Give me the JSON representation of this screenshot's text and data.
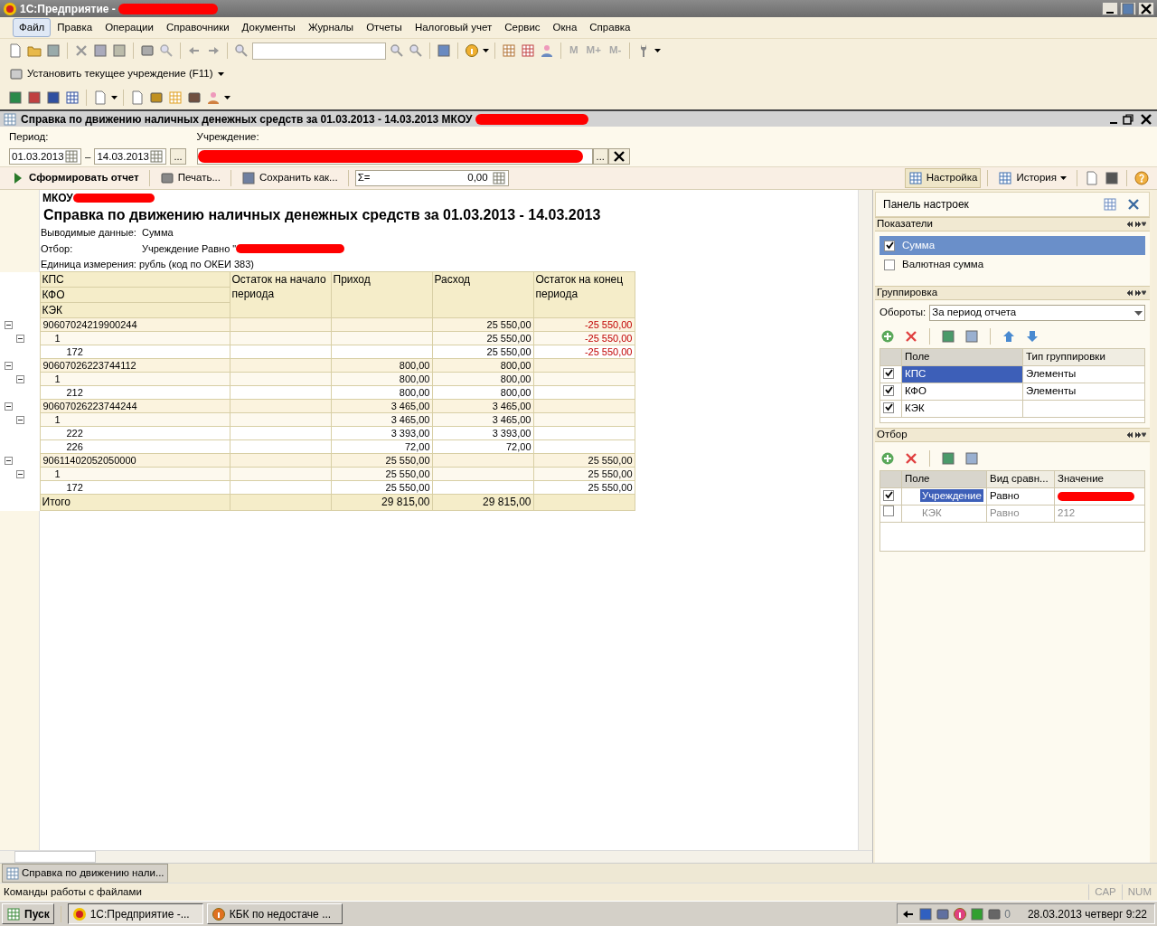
{
  "window": {
    "title": "1С:Предприятие -"
  },
  "menu": [
    {
      "label": "Файл",
      "selected": true
    },
    {
      "label": "Правка",
      "selected": false
    },
    {
      "label": "Операции",
      "selected": false
    },
    {
      "label": "Справочники",
      "selected": false
    },
    {
      "label": "Документы",
      "selected": false
    },
    {
      "label": "Журналы",
      "selected": false
    },
    {
      "label": "Отчеты",
      "selected": false
    },
    {
      "label": "Налоговый учет",
      "selected": false
    },
    {
      "label": "Сервис",
      "selected": false
    },
    {
      "label": "Окна",
      "selected": false
    },
    {
      "label": "Справка",
      "selected": false
    }
  ],
  "toolbar": {
    "memory_buttons": [
      "M",
      "M+",
      "M-"
    ]
  },
  "quick_toolbar": {
    "button": "Установить текущее учреждение (F11)"
  },
  "report_window": {
    "title": "Справка по движению наличных денежных средств за 01.03.2013 - 14.03.2013 МКОУ"
  },
  "form": {
    "period_label": "Период:",
    "date_from": "01.03.2013",
    "date_separator": "–",
    "date_to": "14.03.2013",
    "period_button": "...",
    "institution_label": "Учреждение:",
    "institution_button": "..."
  },
  "command_bar": {
    "buttons": [
      {
        "label": "Сформировать отчет"
      },
      {
        "label": "Печать..."
      },
      {
        "label": "Сохранить как..."
      }
    ],
    "sum_prefix": "Σ=",
    "sum_value": "0,00",
    "right_buttons": [
      {
        "label": "Настройка",
        "selected": true
      },
      {
        "label": "История",
        "selected": false
      }
    ]
  },
  "report": {
    "org_label": "МКОУ",
    "title": "Справка по движению наличных денежных средств за 01.03.2013 - 14.03.2013",
    "params": [
      {
        "label": "Выводимые данные:",
        "value": "Сумма"
      },
      {
        "label": "Отбор:",
        "value": "Учреждение Равно \""
      }
    ],
    "unit": "Единица измерения: рубль (код по ОКЕИ 383)",
    "row_fields": [
      "КПС",
      "КФО",
      "КЭК"
    ],
    "columns": [
      "Остаток на начало периода",
      "Приход",
      "Расход",
      "Остаток на конец периода"
    ],
    "rows": [
      {
        "code": "90607024219900244",
        "cells": [
          "",
          "",
          "25 550,00",
          "-25 550,00"
        ],
        "negative_end": true,
        "expanded": true,
        "children": [
          {
            "code": "1",
            "cells": [
              "",
              "",
              "25 550,00",
              "-25 550,00"
            ],
            "negative_end": true,
            "expanded": true,
            "children": [
              {
                "code": "172",
                "cells": [
                  "",
                  "",
                  "25 550,00",
                  "-25 550,00"
                ],
                "negative_end": true
              }
            ]
          }
        ]
      },
      {
        "code": "90607026223744112",
        "cells": [
          "",
          "800,00",
          "800,00",
          ""
        ],
        "negative_end": false,
        "expanded": true,
        "children": [
          {
            "code": "1",
            "cells": [
              "",
              "800,00",
              "800,00",
              ""
            ],
            "negative_end": false,
            "expanded": true,
            "children": [
              {
                "code": "212",
                "cells": [
                  "",
                  "800,00",
                  "800,00",
                  ""
                ],
                "negative_end": false
              }
            ]
          }
        ]
      },
      {
        "code": "90607026223744244",
        "cells": [
          "",
          "3 465,00",
          "3 465,00",
          ""
        ],
        "negative_end": false,
        "expanded": true,
        "children": [
          {
            "code": "1",
            "cells": [
              "",
              "3 465,00",
              "3 465,00",
              ""
            ],
            "negative_end": false,
            "expanded": true,
            "children": [
              {
                "code": "222",
                "cells": [
                  "",
                  "3 393,00",
                  "3 393,00",
                  ""
                ],
                "negative_end": false
              },
              {
                "code": "226",
                "cells": [
                  "",
                  "72,00",
                  "72,00",
                  ""
                ],
                "negative_end": false
              }
            ]
          }
        ]
      },
      {
        "code": "90611402052050000",
        "cells": [
          "",
          "25 550,00",
          "",
          "25 550,00"
        ],
        "negative_end": false,
        "expanded": true,
        "children": [
          {
            "code": "1",
            "cells": [
              "",
              "25 550,00",
              "",
              "25 550,00"
            ],
            "negative_end": false,
            "expanded": true,
            "children": [
              {
                "code": "172",
                "cells": [
                  "",
                  "25 550,00",
                  "",
                  "25 550,00"
                ],
                "negative_end": false
              }
            ]
          }
        ]
      }
    ],
    "total": {
      "label": "Итого",
      "cells": [
        "",
        "29 815,00",
        "29 815,00",
        ""
      ]
    }
  },
  "settings_panel": {
    "title": "Панель настроек",
    "indicators": {
      "title": "Показатели",
      "items": [
        {
          "label": "Сумма",
          "checked": true,
          "selected": true
        },
        {
          "label": "Валютная сумма",
          "checked": false,
          "selected": false
        }
      ]
    },
    "grouping": {
      "title": "Группировка",
      "turnover_label": "Обороты:",
      "turnover_value": "За период отчета",
      "columns": [
        "Поле",
        "Тип группировки"
      ],
      "rows": [
        {
          "field": "КПС",
          "type": "Элементы",
          "checked": true,
          "selected": true
        },
        {
          "field": "КФО",
          "type": "Элементы",
          "checked": true,
          "selected": false
        },
        {
          "field": "КЭК",
          "checked": true,
          "selected": false
        }
      ]
    },
    "filter": {
      "title": "Отбор",
      "columns": [
        "Поле",
        "Вид сравн...",
        "Значение"
      ],
      "rows": [
        {
          "field": "Учреждение",
          "comparison": "Равно",
          "checked": true,
          "selected": true
        },
        {
          "field": "КЭК",
          "comparison": "Равно",
          "value": "212",
          "checked": false,
          "selected": false
        }
      ]
    }
  },
  "window_tabs": [
    {
      "label": "Справка по движению нали...",
      "selected": true
    }
  ],
  "status_bar": {
    "text": "Команды работы с файлами",
    "indicators": [
      "CAP",
      "NUM"
    ]
  },
  "taskbar": {
    "start": "Пуск",
    "tasks": [
      {
        "label": "1С:Предприятие -...",
        "selected": true
      },
      {
        "label": "КБК по недостаче ...",
        "selected": false
      }
    ],
    "tray_badge": "0",
    "clock": "28.03.2013 четверг 9:22"
  }
}
